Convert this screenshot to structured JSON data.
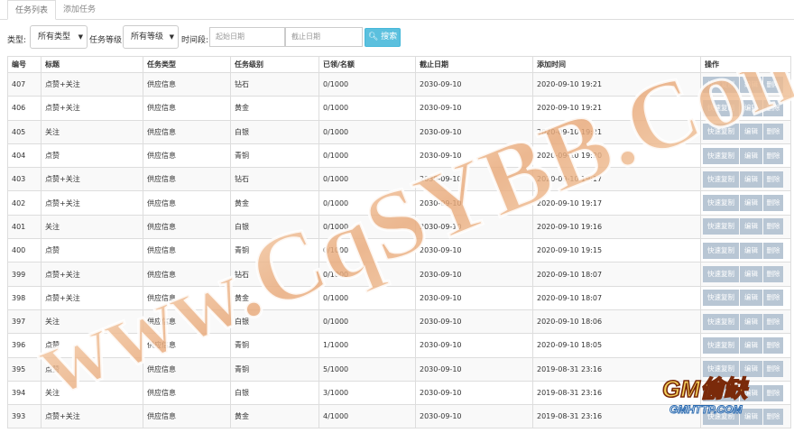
{
  "tabs": [
    "任务列表",
    "添加任务"
  ],
  "filter": {
    "type_label": "类型:",
    "type_value": "所有类型",
    "level_label": "任务等级:",
    "level_value": "所有等级",
    "time_label": "时间段:",
    "start_placeholder": "起始日期",
    "end_placeholder": "截止日期",
    "search_label": "搜索"
  },
  "table": {
    "headers": [
      "编号",
      "标题",
      "任务类型",
      "任务级别",
      "已领/名额",
      "截止日期",
      "添加时间",
      "操作"
    ],
    "op_labels": {
      "quick": "快速复制",
      "edit": "编辑",
      "del": "删除"
    },
    "rows": [
      [
        "407",
        "点赞+关注",
        "供应信息",
        "钻石",
        "0/1000",
        "2030-09-10",
        "2020-09-10 19:21"
      ],
      [
        "406",
        "点赞+关注",
        "供应信息",
        "黄金",
        "0/1000",
        "2030-09-10",
        "2020-09-10 19:21"
      ],
      [
        "405",
        "关注",
        "供应信息",
        "白银",
        "0/1000",
        "2030-09-10",
        "2020-09-10 19:21"
      ],
      [
        "404",
        "点赞",
        "供应信息",
        "青铜",
        "0/1000",
        "2030-09-10",
        "2020-09-10 19:20"
      ],
      [
        "403",
        "点赞+关注",
        "供应信息",
        "钻石",
        "0/1000",
        "2030-09-10",
        "2020-09-10 19:17"
      ],
      [
        "402",
        "点赞+关注",
        "供应信息",
        "黄金",
        "0/1000",
        "2030-09-10",
        "2020-09-10 19:17"
      ],
      [
        "401",
        "关注",
        "供应信息",
        "白银",
        "0/1000",
        "2030-09-10",
        "2020-09-10 19:16"
      ],
      [
        "400",
        "点赞",
        "供应信息",
        "青铜",
        "0/1000",
        "2030-09-10",
        "2020-09-10 19:15"
      ],
      [
        "399",
        "点赞+关注",
        "供应信息",
        "钻石",
        "0/1000",
        "2030-09-10",
        "2020-09-10 18:07"
      ],
      [
        "398",
        "点赞+关注",
        "供应信息",
        "黄金",
        "0/1000",
        "2030-09-10",
        "2020-09-10 18:07"
      ],
      [
        "397",
        "关注",
        "供应信息",
        "白银",
        "0/1000",
        "2030-09-10",
        "2020-09-10 18:06"
      ],
      [
        "396",
        "点赞",
        "供应信息",
        "青铜",
        "1/1000",
        "2030-09-10",
        "2020-09-10 18:05"
      ],
      [
        "395",
        "点赞",
        "供应信息",
        "青铜",
        "5/1000",
        "2030-09-10",
        "2019-08-31 23:16"
      ],
      [
        "394",
        "关注",
        "供应信息",
        "白银",
        "3/1000",
        "2030-09-10",
        "2019-08-31 23:16"
      ],
      [
        "393",
        "点赞+关注",
        "供应信息",
        "黄金",
        "4/1000",
        "2030-09-10",
        "2019-08-31 23:16"
      ]
    ]
  },
  "watermark": {
    "text": "www.CqSYBB.Com",
    "color": "#e8a878"
  },
  "logo": {
    "line1": "GM偷缺",
    "line2": "GMHTTP.COM"
  },
  "colors": {
    "search_button": "#5bc0de",
    "op_button": "#b8c6d4"
  }
}
